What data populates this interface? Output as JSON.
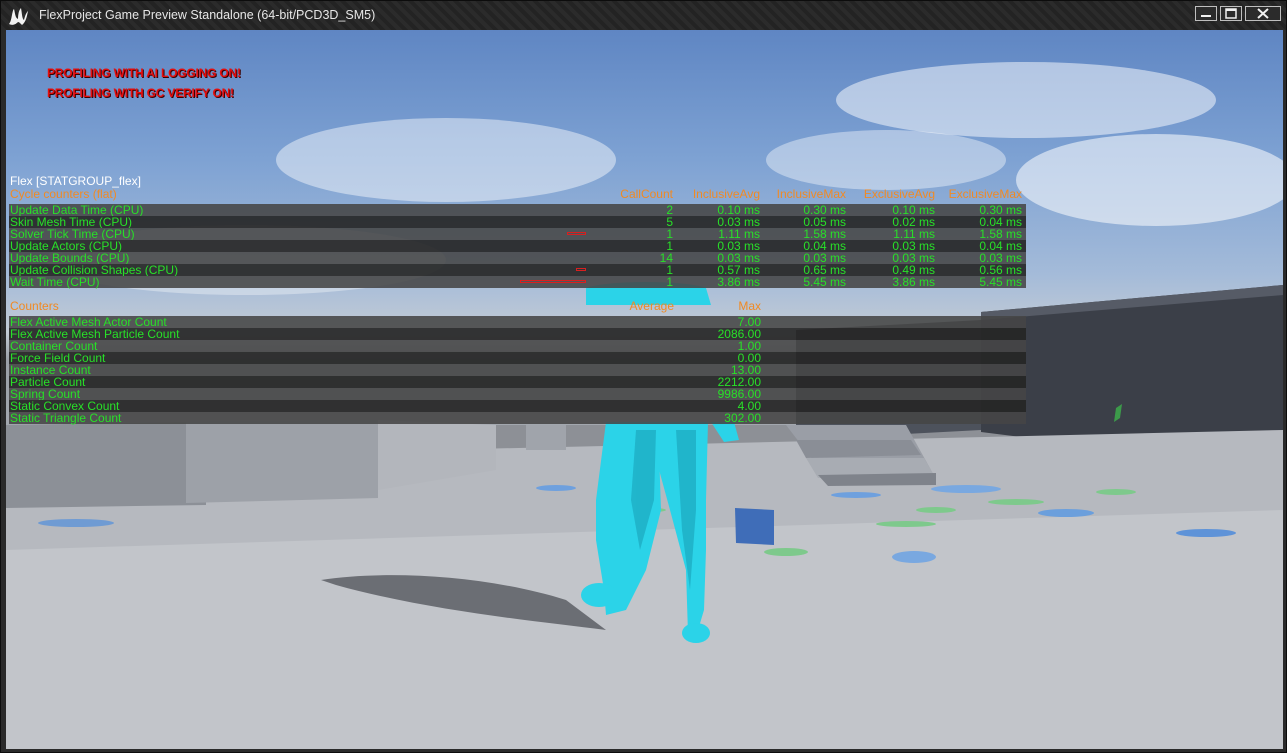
{
  "window": {
    "title": "FlexProject Game Preview Standalone (64-bit/PCD3D_SM5)",
    "icons": {
      "logo": "unreal-engine-logo",
      "minimize": "minimize-icon",
      "maximize": "maximize-icon",
      "close": "close-icon"
    }
  },
  "warnings": {
    "ai_logging": "PROFILING WITH AI LOGGING ON!",
    "gc_verify": "PROFILING WITH GC VERIFY ON!"
  },
  "stats": {
    "group_title": "Flex [STATGROUP_flex]",
    "cycle": {
      "section_label": "Cycle counters (flat)",
      "columns": [
        "CallCount",
        "InclusiveAvg",
        "InclusiveMax",
        "ExclusiveAvg",
        "ExclusiveMax"
      ],
      "rows": [
        {
          "name": "Update Data Time (CPU)",
          "callcount": "2",
          "incl_avg": "0.10 ms",
          "incl_max": "0.30 ms",
          "excl_avg": "0.10 ms",
          "excl_max": "0.30 ms",
          "bar_fraction": 0.0
        },
        {
          "name": "Skin Mesh Time (CPU)",
          "callcount": "5",
          "incl_avg": "0.03 ms",
          "incl_max": "0.05 ms",
          "excl_avg": "0.02 ms",
          "excl_max": "0.04 ms",
          "bar_fraction": 0.0
        },
        {
          "name": "Solver Tick Time (CPU)",
          "callcount": "1",
          "incl_avg": "1.11 ms",
          "incl_max": "1.58 ms",
          "excl_avg": "1.11 ms",
          "excl_max": "1.58 ms",
          "bar_fraction": 0.29
        },
        {
          "name": "Update Actors (CPU)",
          "callcount": "1",
          "incl_avg": "0.03 ms",
          "incl_max": "0.04 ms",
          "excl_avg": "0.03 ms",
          "excl_max": "0.04 ms",
          "bar_fraction": 0.0
        },
        {
          "name": "Update Bounds (CPU)",
          "callcount": "14",
          "incl_avg": "0.03 ms",
          "incl_max": "0.03 ms",
          "excl_avg": "0.03 ms",
          "excl_max": "0.03 ms",
          "bar_fraction": 0.0
        },
        {
          "name": "Update Collision Shapes (CPU)",
          "callcount": "1",
          "incl_avg": "0.57 ms",
          "incl_max": "0.65 ms",
          "excl_avg": "0.49 ms",
          "excl_max": "0.56 ms",
          "bar_fraction": 0.15
        },
        {
          "name": "Wait Time (CPU)",
          "callcount": "1",
          "incl_avg": "3.86 ms",
          "incl_max": "5.45 ms",
          "excl_avg": "3.86 ms",
          "excl_max": "5.45 ms",
          "bar_fraction": 1.0
        }
      ]
    },
    "counters": {
      "section_label": "Counters",
      "columns": [
        "Average",
        "Max"
      ],
      "rows": [
        {
          "name": "Flex Active Mesh Actor Count",
          "max": "7.00"
        },
        {
          "name": "Flex Active Mesh Particle Count",
          "max": "2086.00"
        },
        {
          "name": "Container Count",
          "max": "1.00"
        },
        {
          "name": "Force Field Count",
          "max": "0.00"
        },
        {
          "name": "Instance Count",
          "max": "13.00"
        },
        {
          "name": "Particle Count",
          "max": "2212.00"
        },
        {
          "name": "Spring Count",
          "max": "9986.00"
        },
        {
          "name": "Static Convex Count",
          "max": "4.00"
        },
        {
          "name": "Static Triangle Count",
          "max": "302.00"
        }
      ]
    }
  },
  "colors": {
    "stat_text": "#28e028",
    "header_text": "#f08a24",
    "warning_text": "#e40e0e",
    "character": "#2bd3e8"
  }
}
